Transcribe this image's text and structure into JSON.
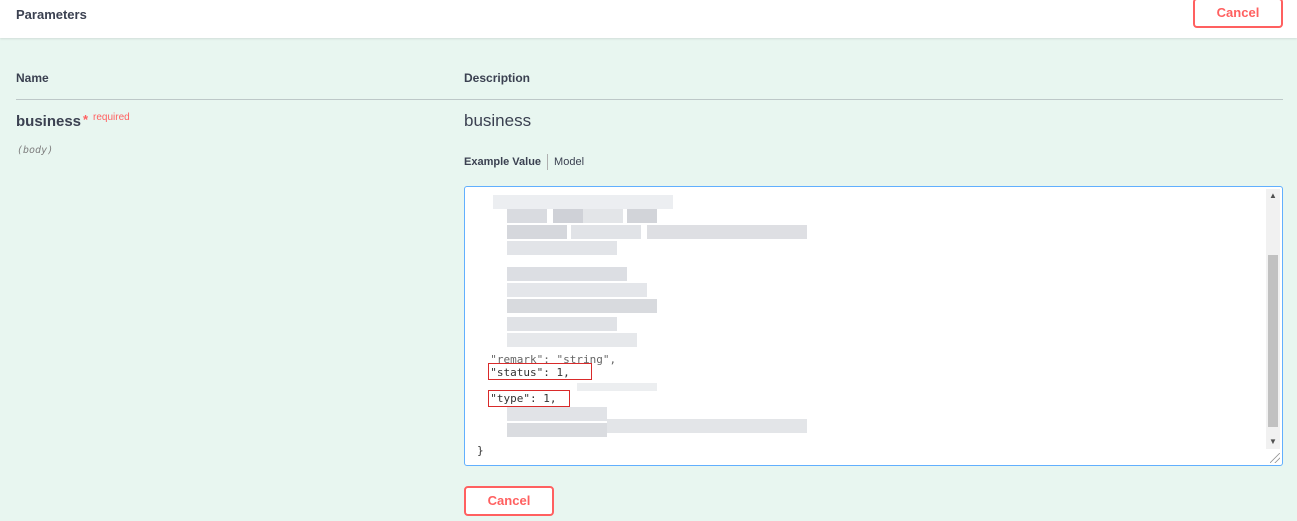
{
  "header": {
    "title": "Parameters",
    "cancel_label": "Cancel"
  },
  "columns": {
    "name": "Name",
    "description": "Description"
  },
  "parameter": {
    "name": "business",
    "required_star": "*",
    "required_label": "required",
    "in": "(body)",
    "description": "business"
  },
  "tabs": {
    "example_value": "Example Value",
    "model": "Model"
  },
  "editor": {
    "visible_lines": [
      "  \"remark\": \"string\",",
      "  \"status\": 1,",
      "  \"type\": 1,",
      "}"
    ],
    "highlighted_fields": [
      "\"status\": 1,",
      "\"type\": 1,"
    ]
  },
  "footer": {
    "cancel_label": "Cancel"
  },
  "colors": {
    "accent_red": "#ff6060",
    "editor_border": "#61affe",
    "background": "#e8f6f0"
  }
}
